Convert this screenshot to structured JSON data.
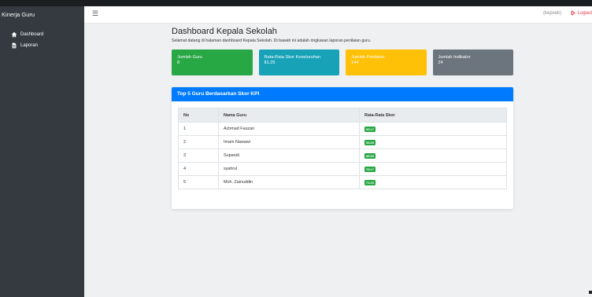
{
  "brand": {
    "title": "Kinerja Guru"
  },
  "topbar": {
    "menu_icon": "bars-icon",
    "user_label": "(kepsek)",
    "logout_label": "Logout"
  },
  "sidebar": {
    "items": [
      {
        "label": "Dashboard",
        "icon": "home-icon"
      },
      {
        "label": "Laporan",
        "icon": "file-icon"
      }
    ]
  },
  "main": {
    "title": "Dashboard Kepala Sekolah",
    "intro": "Selamat datang di halaman dashboard Kepala Sekolah. Di bawah ini adalah ringkasan laporan penilaian guru.",
    "cards": [
      {
        "label": "Jumlah Guru",
        "value": "8",
        "color": "#28a745"
      },
      {
        "label": "Rata-Rata Skor Keseluruhan",
        "value": "81.25",
        "color": "#17a2b8"
      },
      {
        "label": "Jumlah Penilaian",
        "value": "144",
        "color": "#ffc107"
      },
      {
        "label": "Jumlah Indikator",
        "value": "24",
        "color": "#6c757d"
      }
    ],
    "panel": {
      "title": "Top 5 Guru Berdasarkan Skor KPI",
      "columns": [
        "No",
        "Nama Guru",
        "Rata-Rata Skor"
      ],
      "rows": [
        {
          "no": "1",
          "name": "Achmad Fauzan",
          "score": "99.17"
        },
        {
          "no": "2",
          "name": "Imam Nawawi",
          "score": "98.83"
        },
        {
          "no": "3",
          "name": "Supandi",
          "score": "85.00"
        },
        {
          "no": "4",
          "name": "syahrul",
          "score": "78.17"
        },
        {
          "no": "5",
          "name": "Moh. Zainuddin",
          "score": "73.33"
        }
      ]
    }
  }
}
